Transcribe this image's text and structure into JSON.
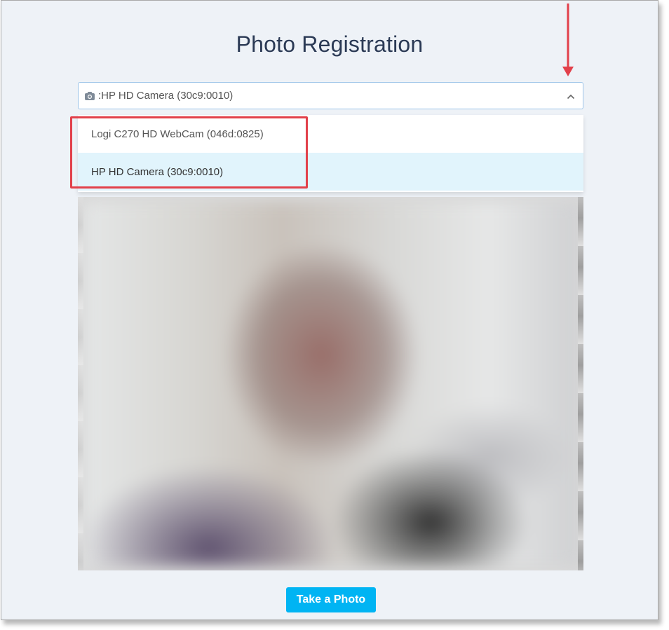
{
  "page": {
    "title": "Photo Registration"
  },
  "camera_select": {
    "value": ":HP HD Camera (30c9:0010)",
    "icon": "camera-icon",
    "expanded": true,
    "options": [
      {
        "label": "Logi C270 HD WebCam (046d:0825)",
        "selected": false
      },
      {
        "label": "HP HD Camera (30c9:0010)",
        "selected": true
      }
    ]
  },
  "actions": {
    "take_photo_label": "Take a Photo"
  },
  "annotations": {
    "highlight_color": "#e2404a",
    "arrow_color": "#e2404a"
  },
  "colors": {
    "accent": "#00b4f3",
    "title": "#2b3a55",
    "selected_option_bg": "#e1f4fc",
    "page_bg": "#eef2f7"
  }
}
